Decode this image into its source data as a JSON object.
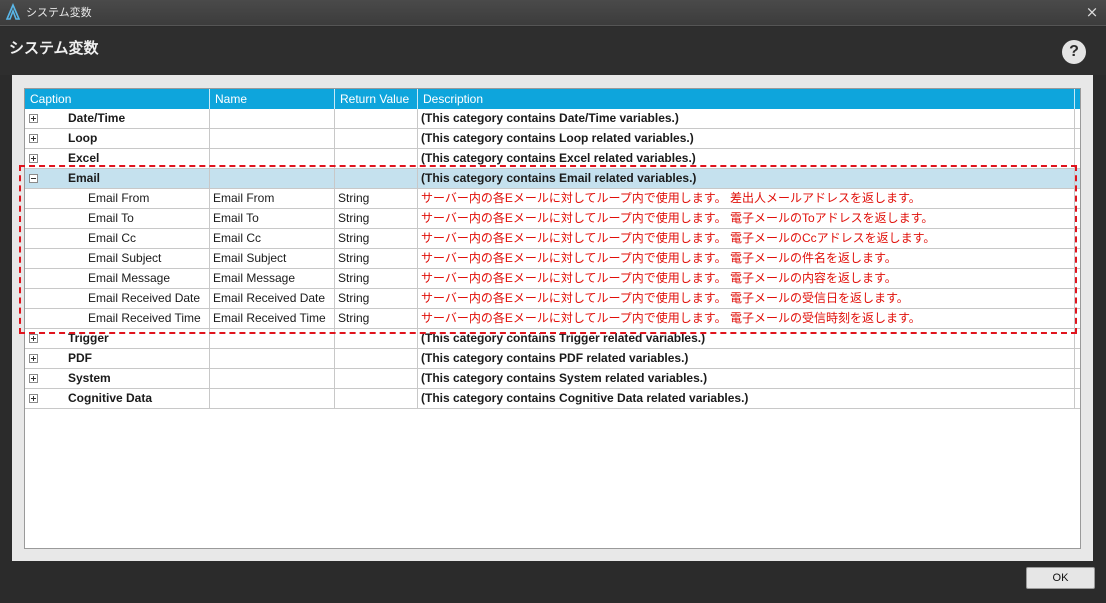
{
  "window": {
    "title": "システム変数",
    "close_label": "×"
  },
  "header": {
    "title": "システム変数",
    "help_label": "?"
  },
  "grid": {
    "columns": [
      "Caption",
      "Name",
      "Return Value",
      "Description"
    ],
    "rows": [
      {
        "caption": "Date/Time",
        "name": "",
        "return_value": "",
        "description": "(This category contains Date/Time variables.)"
      },
      {
        "caption": "Loop",
        "name": "",
        "return_value": "",
        "description": "(This category contains Loop related variables.)"
      },
      {
        "caption": "Excel",
        "name": "",
        "return_value": "",
        "description": "(This category contains Excel related variables.)"
      },
      {
        "caption": "Email",
        "name": "",
        "return_value": "",
        "description": "(This category contains Email related variables.)"
      },
      {
        "caption": "Email From",
        "name": "Email From",
        "return_value": "String",
        "description": "サーバー内の各Eメールに対してループ内で使用します。 差出人メールアドレスを返します。"
      },
      {
        "caption": "Email To",
        "name": "Email To",
        "return_value": "String",
        "description": "サーバー内の各Eメールに対してループ内で使用します。 電子メールのToアドレスを返します。"
      },
      {
        "caption": "Email Cc",
        "name": "Email Cc",
        "return_value": "String",
        "description": "サーバー内の各Eメールに対してループ内で使用します。 電子メールのCcアドレスを返します。"
      },
      {
        "caption": "Email Subject",
        "name": "Email Subject",
        "return_value": "String",
        "description": "サーバー内の各Eメールに対してループ内で使用します。 電子メールの件名を返します。"
      },
      {
        "caption": "Email Message",
        "name": "Email Message",
        "return_value": "String",
        "description": "サーバー内の各Eメールに対してループ内で使用します。 電子メールの内容を返します。"
      },
      {
        "caption": "Email Received Date",
        "name": "Email Received Date",
        "return_value": "String",
        "description": "サーバー内の各Eメールに対してループ内で使用します。 電子メールの受信日を返します。"
      },
      {
        "caption": "Email Received Time",
        "name": "Email Received Time",
        "return_value": "String",
        "description": "サーバー内の各Eメールに対してループ内で使用します。 電子メールの受信時刻を返します。"
      },
      {
        "caption": "Trigger",
        "name": "",
        "return_value": "",
        "description": "(This category contains Trigger related variables.)"
      },
      {
        "caption": "PDF",
        "name": "",
        "return_value": "",
        "description": "(This category contains PDF related variables.)"
      },
      {
        "caption": "System",
        "name": "",
        "return_value": "",
        "description": "(This category contains System related variables.)"
      },
      {
        "caption": "Cognitive Data",
        "name": "",
        "return_value": "",
        "description": "(This category contains Cognitive Data related variables.)"
      }
    ]
  },
  "footer": {
    "ok_label": "OK"
  },
  "colors": {
    "header_blue": "#0ea5dc",
    "selected_row": "#c5e1ee",
    "description_red": "#e0100a",
    "highlight_dash": "#e0141e"
  }
}
